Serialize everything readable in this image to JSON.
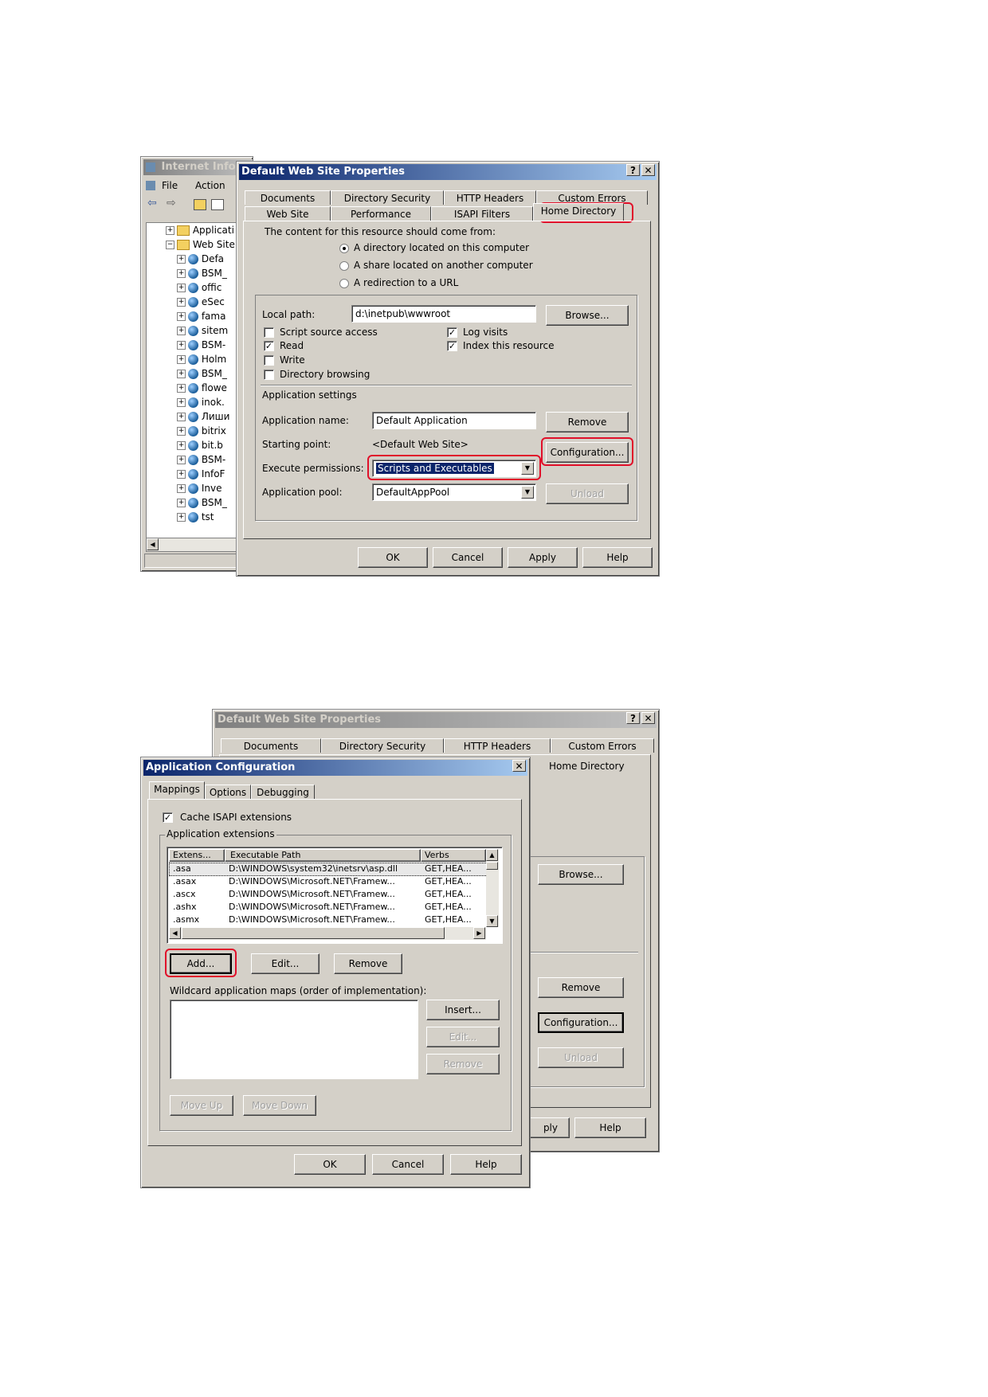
{
  "iis": {
    "title": "Internet Information Services",
    "menu": [
      "File",
      "Action"
    ],
    "tree_top": [
      "Applicati",
      "Web Site"
    ],
    "sites": [
      "Defa",
      "BSM_",
      "offic",
      "eSec",
      "fama",
      "sitem",
      "BSM-",
      "Holm",
      "BSM_",
      "flowe",
      "inok.",
      "Лиши",
      "bitrix",
      "bit.b",
      "BSM-",
      "InfoF",
      "Inve",
      "BSM_",
      "tst"
    ]
  },
  "props": {
    "title": "Default Web Site Properties",
    "help_glyph": "?",
    "close_glyph": "✕",
    "tabs_back": [
      "Documents",
      "Directory Security",
      "HTTP Headers",
      "Custom Errors"
    ],
    "tabs_front": [
      "Web Site",
      "Performance",
      "ISAPI Filters",
      "Home Directory"
    ],
    "content_source_label": "The content for this resource should come from:",
    "radio_options": [
      "A directory located on this computer",
      "A share located on another computer",
      "A redirection to a URL"
    ],
    "local_path_label": "Local path:",
    "local_path_value": "d:\\inetpub\\wwwroot",
    "browse_label": "Browse...",
    "checks_left": [
      {
        "label": "Script source access",
        "checked": false
      },
      {
        "label": "Read",
        "checked": true
      },
      {
        "label": "Write",
        "checked": false
      },
      {
        "label": "Directory browsing",
        "checked": false
      }
    ],
    "checks_right": [
      {
        "label": "Log visits",
        "checked": true
      },
      {
        "label": "Index this resource",
        "checked": true
      }
    ],
    "app_settings_label": "Application settings",
    "app_name_label": "Application name:",
    "app_name_value": "Default Application",
    "remove_label": "Remove",
    "starting_point_label": "Starting point:",
    "starting_point_value": "<Default Web Site>",
    "configuration_label": "Configuration...",
    "exec_perm_label": "Execute permissions:",
    "exec_perm_value": "Scripts and Executables",
    "app_pool_label": "Application pool:",
    "app_pool_value": "DefaultAppPool",
    "unload_label": "Unload",
    "ok_label": "OK",
    "cancel_label": "Cancel",
    "apply_label": "Apply",
    "help_label": "Help"
  },
  "props2": {
    "title": "Default Web Site Properties",
    "tabs_back": [
      "Documents",
      "Directory Security",
      "HTTP Headers",
      "Custom Errors"
    ],
    "home_directory_label": "Home Directory",
    "browse_label": "Browse...",
    "remove_label": "Remove",
    "configuration_label": "Configuration...",
    "unload_label": "Unload",
    "apply_partial": "ply",
    "help_label": "Help"
  },
  "appconfig": {
    "title": "Application Configuration",
    "tabs": [
      "Mappings",
      "Options",
      "Debugging"
    ],
    "cache_label": "Cache ISAPI extensions",
    "extensions_group_label": "Application extensions",
    "columns": [
      "Extens...",
      "Executable Path",
      "Verbs"
    ],
    "rows": [
      {
        "ext": ".asa",
        "path": "D:\\WINDOWS\\system32\\inetsrv\\asp.dll",
        "verbs": "GET,HEA..."
      },
      {
        "ext": ".asax",
        "path": "D:\\WINDOWS\\Microsoft.NET\\Framew...",
        "verbs": "GET,HEA..."
      },
      {
        "ext": ".ascx",
        "path": "D:\\WINDOWS\\Microsoft.NET\\Framew...",
        "verbs": "GET,HEA..."
      },
      {
        "ext": ".ashx",
        "path": "D:\\WINDOWS\\Microsoft.NET\\Framew...",
        "verbs": "GET,HEA..."
      },
      {
        "ext": ".asmx",
        "path": "D:\\WINDOWS\\Microsoft.NET\\Framew...",
        "verbs": "GET,HEA..."
      }
    ],
    "add_label": "Add...",
    "edit_label": "Edit...",
    "remove_label": "Remove",
    "wildcard_label": "Wildcard application maps (order of implementation):",
    "insert_label": "Insert...",
    "wild_edit_label": "Edit...",
    "wild_remove_label": "Remove",
    "move_up_label": "Move Up",
    "move_down_label": "Move Down",
    "ok_label": "OK",
    "cancel_label": "Cancel",
    "help_label": "Help"
  }
}
